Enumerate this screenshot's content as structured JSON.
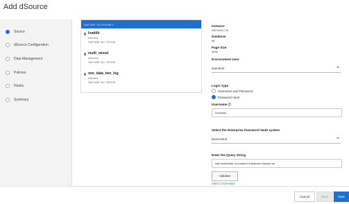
{
  "title": "Add dSource",
  "steps": [
    {
      "label": "Source",
      "active": true
    },
    {
      "label": "dSource Configuration",
      "active": false
    },
    {
      "label": "Data Management",
      "active": false
    },
    {
      "label": "Policies",
      "active": false
    },
    {
      "label": "Hooks",
      "active": false
    },
    {
      "label": "Summary",
      "active": false
    }
  ],
  "groups": {
    "selected_text": "SAP ASE 15.0 ESD#6.1",
    "items": [
      {
        "name": "loaddb",
        "env": "rhel-env",
        "version": "SAP ASE 15.7 SP138"
      },
      {
        "name": "multi_mixed",
        "env": "rhel-env",
        "version": "SAP ASE 15.7 SP138"
      },
      {
        "name": "one_data_two_log",
        "env": "rhel-env",
        "version": "SAP ASE 15.7 SP138"
      }
    ]
  },
  "form": {
    "instance_label": "Instance",
    "instance_value": "ASE1540_S6",
    "database_label": "Database",
    "database_value": "fdj",
    "page_size_label": "Page Size",
    "page_size_value": "4096",
    "env_user_label": "Environment User",
    "env_user_value": "anyname",
    "login_type_label": "Login Type",
    "login_option_1": "Username and Password",
    "login_option_2": "Password Vault",
    "username_label": "Username ⓘ",
    "username_value": "namesey",
    "vault_label": "Select the Enterprise Password Vault system",
    "vault_value": "DemoVault",
    "query_label": "Enter the Query String",
    "query_value": "safe-test/folder-root;object=Database-Sybase-sa",
    "validate_label": "Validate",
    "valid_text": "Valid Credentials"
  },
  "footer": {
    "cancel": "Cancel",
    "back": "Back",
    "next": "Next"
  },
  "colors": {
    "accent": "#1f6fd1",
    "valid": "#3a9b2e"
  }
}
